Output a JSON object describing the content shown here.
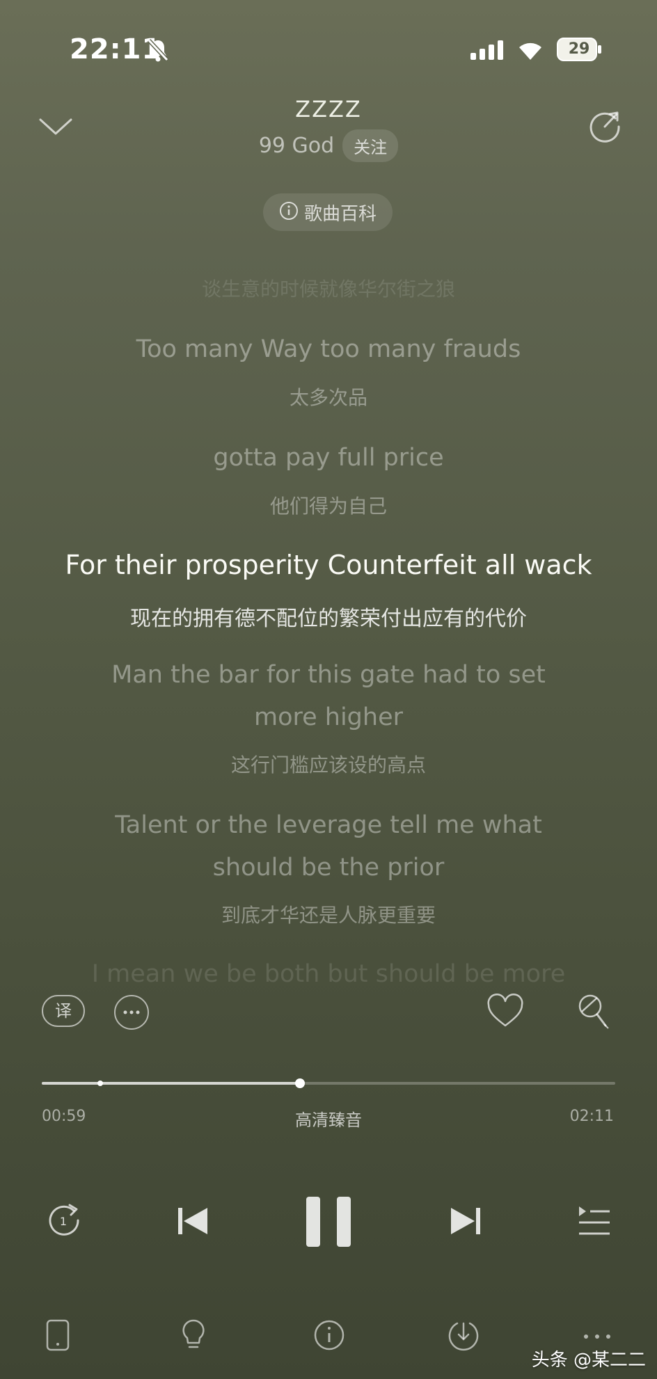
{
  "status_bar": {
    "time": "22:11",
    "battery": "29"
  },
  "header": {
    "song_title": "ZZZZ",
    "artist": "99 God",
    "follow_label": "关注",
    "song_wiki_label": "歌曲百科"
  },
  "lyrics": [
    {
      "text": "谈生意的时候就像华尔街之狼",
      "lang": "zh",
      "state": "faded"
    },
    {
      "text": "Too many Way too many frauds",
      "lang": "en",
      "state": "inactive"
    },
    {
      "text": "太多次品",
      "lang": "zh",
      "state": "inactive"
    },
    {
      "text": "gotta pay full price",
      "lang": "en",
      "state": "inactive"
    },
    {
      "text": "他们得为自己",
      "lang": "zh",
      "state": "inactive"
    },
    {
      "text": "For their prosperity Counterfeit all wack",
      "lang": "en",
      "state": "active"
    },
    {
      "text": "现在的拥有德不配位的繁荣付出应有的代价",
      "lang": "zh",
      "state": "active"
    },
    {
      "text": "Man the bar for this gate had to set",
      "lang": "en",
      "state": "inactive"
    },
    {
      "text": "more higher",
      "lang": "en",
      "state": "inactive"
    },
    {
      "text": "这行门槛应该设的高点",
      "lang": "zh",
      "state": "inactive"
    },
    {
      "text": "Talent or the leverage tell me what",
      "lang": "en",
      "state": "inactive"
    },
    {
      "text": "should be the prior",
      "lang": "en",
      "state": "inactive"
    },
    {
      "text": "到底才华还是人脉更重要",
      "lang": "zh",
      "state": "inactive"
    },
    {
      "text": "I mean we be both but should be more",
      "lang": "en",
      "state": "faded"
    }
  ],
  "actions": {
    "translate_label": "译"
  },
  "player": {
    "elapsed": "00:59",
    "total": "02:11",
    "quality_label": "高清臻音",
    "progress": 0.45
  },
  "watermark": "头条 @某二二",
  "colors": {
    "background_top": "#6a6e57",
    "background_bottom": "#3f4533",
    "active_lyric": "#fbfbf6"
  },
  "icons": [
    "bell-off-icon",
    "signal-icon",
    "wifi-icon",
    "battery-icon",
    "chevron-down-icon",
    "share-icon",
    "info-icon",
    "translate-icon",
    "more-icon",
    "heart-icon",
    "mic-icon",
    "repeat-one-icon",
    "previous-icon",
    "pause-icon",
    "next-icon",
    "playlist-icon",
    "phone-icon",
    "lightbulb-icon",
    "download-icon",
    "dots-icon"
  ]
}
